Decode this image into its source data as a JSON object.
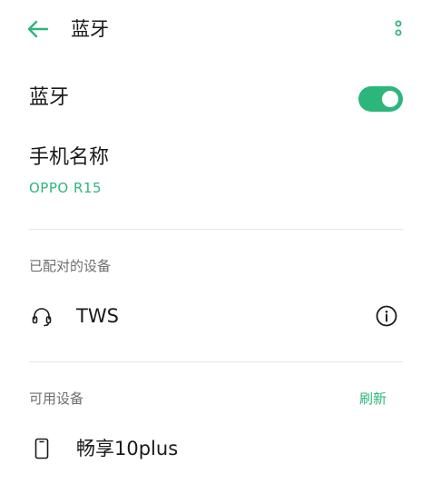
{
  "header": {
    "title": "蓝牙",
    "back_icon": "arrow-left-icon",
    "more_icon": "more-vertical-icon"
  },
  "bluetooth": {
    "label": "蓝牙",
    "enabled": true
  },
  "phone_name": {
    "label": "手机名称",
    "value": "OPPO R15"
  },
  "paired": {
    "header": "已配对的设备",
    "devices": [
      {
        "name": "TWS",
        "icon": "headset-icon",
        "action_icon": "info-icon"
      }
    ]
  },
  "available": {
    "header": "可用设备",
    "refresh_label": "刷新",
    "devices": [
      {
        "name": "畅享10plus",
        "icon": "phone-icon"
      }
    ]
  },
  "colors": {
    "accent": "#2db67c",
    "text": "#1a1a1a",
    "secondary_text": "#6e6e6e",
    "divider": "#e6e6e6"
  }
}
